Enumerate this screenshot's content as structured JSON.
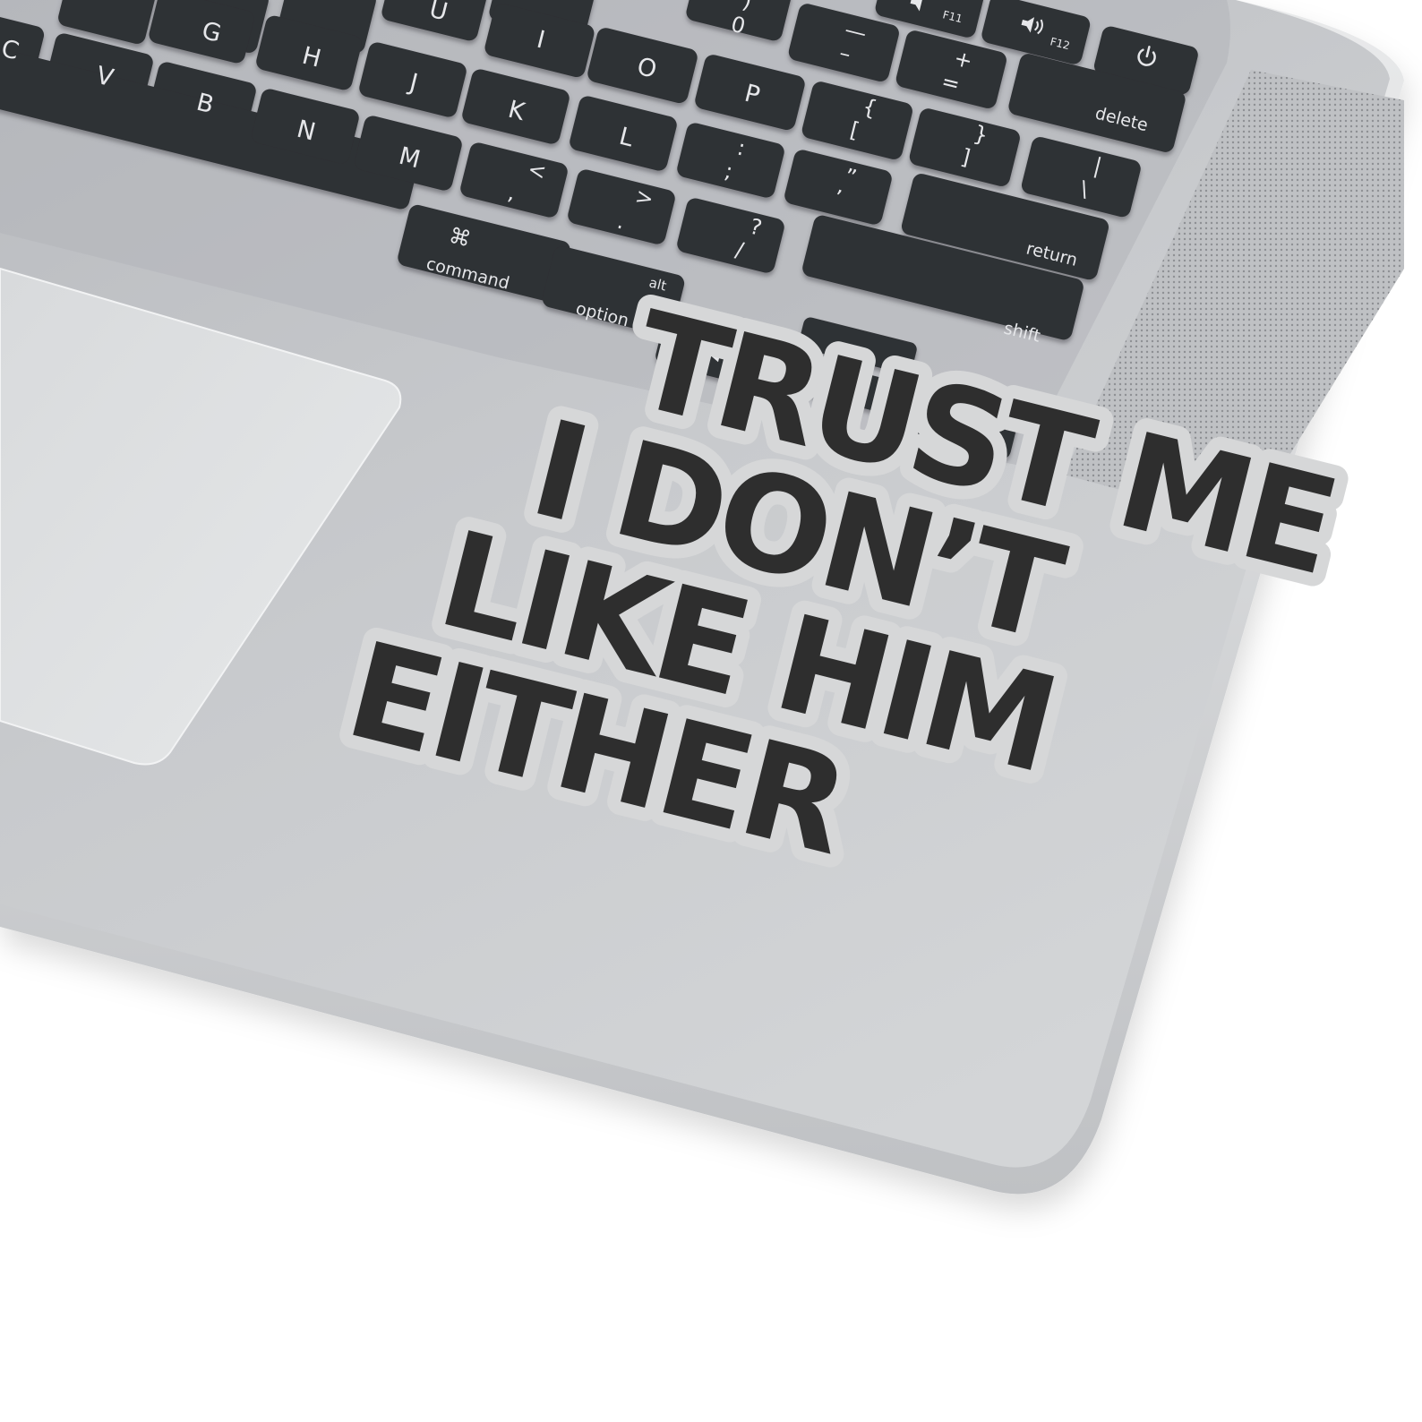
{
  "colors": {
    "background": "#ffffff",
    "laptop_body": "#c9cbce",
    "trackpad": "#e0e2e4",
    "key": "#2f3034",
    "key_label": "#e6e7ea",
    "sticker_text": "#2e2e2e",
    "sticker_outline": "#d6d7d8"
  },
  "keyboard": {
    "letters": {
      "g": "G",
      "h": "H",
      "j": "J",
      "k": "K",
      "l": "L",
      "c": "C",
      "v": "V",
      "b": "B",
      "n": "N",
      "m": "M",
      "u": "U",
      "i": "I",
      "o": "O",
      "p": "P"
    },
    "symbols": {
      "zero": "0",
      "zero_top": ")",
      "minus_top": "—",
      "minus": "–",
      "plus": "+",
      "equals": "=",
      "brace_open": "{",
      "bracket_open": "[",
      "brace_close": "}",
      "bracket_close": "]",
      "pipe": "|",
      "backslash": "\\",
      "colon": ":",
      "semicolon": ";",
      "quote": "”",
      "apostrophe": "’",
      "less": "<",
      "comma": ",",
      "greater": ">",
      "period": ".",
      "question": "?",
      "slash": "/",
      "cmd_symbol": "⌘"
    },
    "modifiers": {
      "delete": "delete",
      "return": "return",
      "shift": "shift",
      "command": "command",
      "option": "option",
      "alt": "alt"
    },
    "function_keys": {
      "f11": "F11",
      "f12": "F12"
    },
    "arrows": {
      "left": "◀",
      "up": "▲",
      "down": "▼",
      "right": "▶"
    },
    "icons": [
      "volume-icon",
      "volume-up-icon",
      "power-icon"
    ]
  },
  "sticker": {
    "lines": [
      "TRUST ME",
      "I DON’T",
      "LIKE HIM",
      "EITHER"
    ]
  }
}
